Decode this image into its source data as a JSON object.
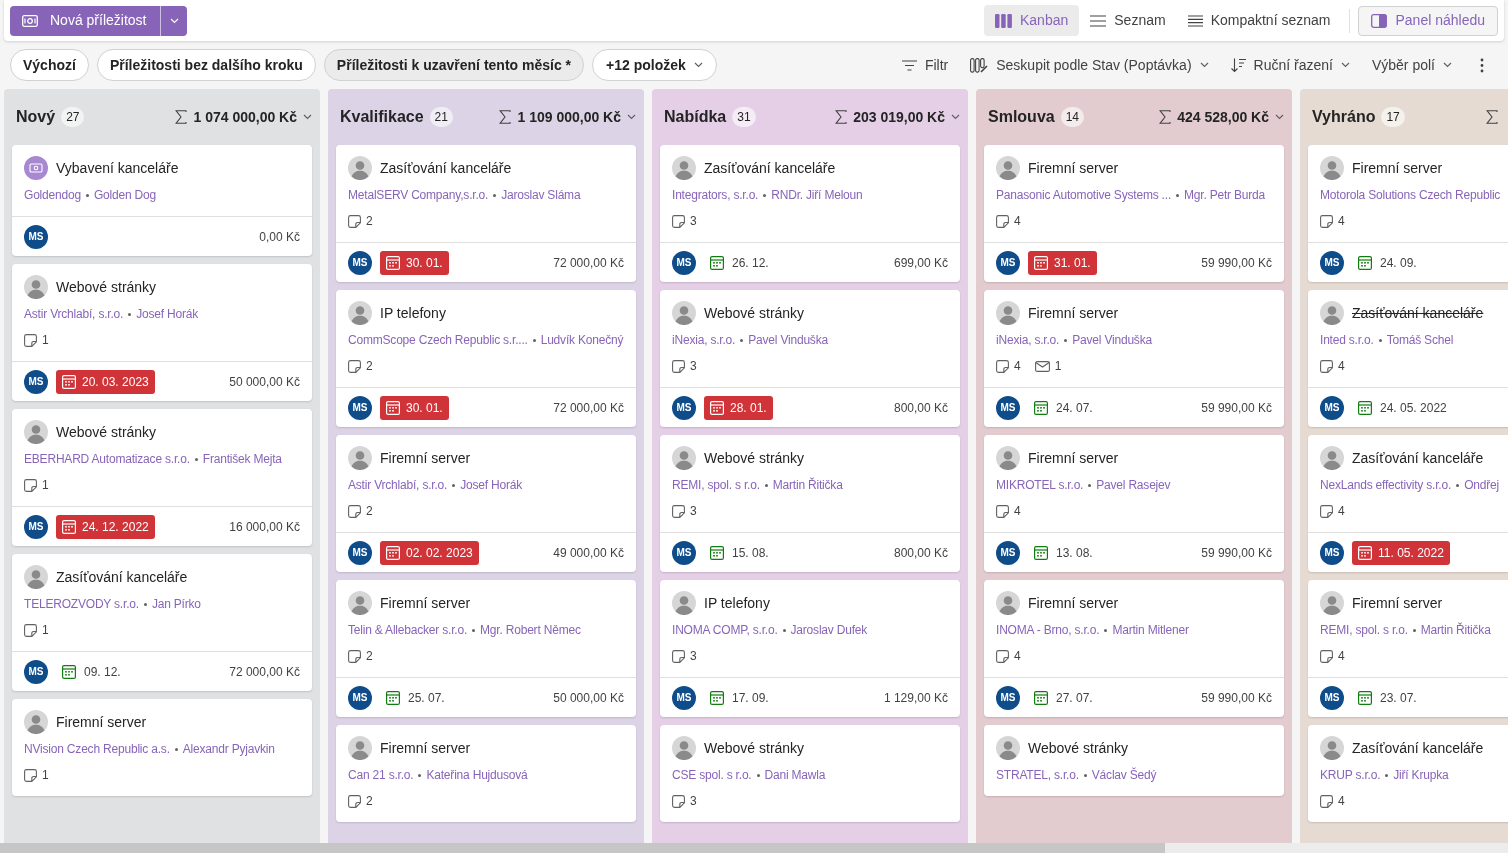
{
  "new_button": {
    "label": "Nová příležitost"
  },
  "views": [
    {
      "label": "Kanban",
      "kind": "kanban",
      "selected": true
    },
    {
      "label": "Seznam",
      "kind": "list",
      "selected": false
    },
    {
      "label": "Kompaktní seznam",
      "kind": "compact",
      "selected": false
    }
  ],
  "preview_button": {
    "label": "Panel náhledu"
  },
  "saved_filters": [
    {
      "label": "Výchozí",
      "selected": false
    },
    {
      "label": "Příležitosti bez dalšího kroku",
      "selected": false
    },
    {
      "label": "Příležitosti k uzavření tento měsíc *",
      "selected": true
    }
  ],
  "more_filters": {
    "label": "+12 položek"
  },
  "commands": [
    {
      "label": "Filtr",
      "kind": "filter",
      "dropdown": false
    },
    {
      "label": "Seskupit podle Stav (Poptávka)",
      "kind": "group",
      "dropdown": true
    },
    {
      "label": "Ruční řazení",
      "kind": "sort",
      "dropdown": true
    },
    {
      "label": "Výběr polí",
      "kind": "fields",
      "dropdown": true
    }
  ],
  "columns": [
    {
      "title": "Nový",
      "count": "27",
      "sum": "1 074 000,00 Kč",
      "color": "#dfe1e2",
      "cards": [
        {
          "kind": "opportunity",
          "title": "Vybavení kanceláře",
          "strikethrough": false,
          "company": "Goldendog",
          "contact": "Golden Dog",
          "footer": {
            "owner": "MS",
            "amount": "0,00 Kč"
          }
        },
        {
          "kind": "person",
          "title": "Webové stránky",
          "strikethrough": false,
          "company": "Astir Vrchlabí, s.r.o.",
          "contact": "Josef Horák",
          "notes": "1",
          "footer": {
            "owner": "MS",
            "date": "20. 03. 2023",
            "overdue": true,
            "amount": "50 000,00 Kč"
          }
        },
        {
          "kind": "person",
          "title": "Webové stránky",
          "strikethrough": false,
          "company": "EBERHARD Automatizace s.r.o.",
          "contact": "František Mejta",
          "notes": "1",
          "footer": {
            "owner": "MS",
            "date": "24. 12. 2022",
            "overdue": true,
            "amount": "16 000,00 Kč"
          }
        },
        {
          "kind": "person",
          "title": "Zasíťování kanceláře",
          "strikethrough": false,
          "company": "TELEROZVODY s.r.o.",
          "contact": "Jan Pírko",
          "notes": "1",
          "footer": {
            "owner": "MS",
            "date": "09. 12.",
            "overdue": false,
            "amount": "72 000,00 Kč"
          }
        },
        {
          "kind": "person",
          "title": "Firemní server",
          "strikethrough": false,
          "company": "NVision Czech Republic a.s.",
          "contact": "Alexandr Pyjavkin",
          "notes": "1"
        }
      ]
    },
    {
      "title": "Kvalifikace",
      "count": "21",
      "sum": "1 109 000,00 Kč",
      "color": "#ddd3e6",
      "cards": [
        {
          "kind": "person",
          "title": "Zasíťování kanceláře",
          "strikethrough": false,
          "company": "MetalSERV Company,s.r.o.",
          "contact": "Jaroslav Sláma",
          "notes": "2",
          "footer": {
            "owner": "MS",
            "date": "30. 01.",
            "overdue": true,
            "amount": "72 000,00 Kč"
          }
        },
        {
          "kind": "person",
          "title": "IP telefony",
          "strikethrough": false,
          "company": "CommScope Czech Republic s.r....",
          "contact": "Ludvík Konečný",
          "notes": "2",
          "footer": {
            "owner": "MS",
            "date": "30. 01.",
            "overdue": true,
            "amount": "72 000,00 Kč"
          }
        },
        {
          "kind": "person",
          "title": "Firemní server",
          "strikethrough": false,
          "company": "Astir Vrchlabí, s.r.o.",
          "contact": "Josef Horák",
          "notes": "2",
          "footer": {
            "owner": "MS",
            "date": "02. 02. 2023",
            "overdue": true,
            "amount": "49 000,00 Kč"
          }
        },
        {
          "kind": "person",
          "title": "Firemní server",
          "strikethrough": false,
          "company": "Telin & Allebacker s.r.o.",
          "contact": "Mgr. Robert Němec",
          "notes": "2",
          "footer": {
            "owner": "MS",
            "date": "25. 07.",
            "overdue": false,
            "amount": "50 000,00 Kč"
          }
        },
        {
          "kind": "person",
          "title": "Firemní server",
          "strikethrough": false,
          "company": "Can 21 s.r.o.",
          "contact": "Kateřina Hujdusová",
          "notes": "2"
        }
      ]
    },
    {
      "title": "Nabídka",
      "count": "31",
      "sum": "203 019,00 Kč",
      "color": "#e5cfe7",
      "cards": [
        {
          "kind": "person",
          "title": "Zasíťování kanceláře",
          "strikethrough": false,
          "company": "Integrators, s.r.o.",
          "contact": "RNDr. Jiří Meloun",
          "notes": "3",
          "footer": {
            "owner": "MS",
            "date": "26. 12.",
            "overdue": false,
            "amount": "699,00 Kč"
          }
        },
        {
          "kind": "person",
          "title": "Webové stránky",
          "strikethrough": false,
          "company": "iNexia, s.r.o.",
          "contact": "Pavel Vinduška",
          "notes": "3",
          "footer": {
            "owner": "MS",
            "date": "28. 01.",
            "overdue": true,
            "amount": "800,00 Kč"
          }
        },
        {
          "kind": "person",
          "title": "Webové stránky",
          "strikethrough": false,
          "company": "REMI, spol. s r.o.",
          "contact": "Martin Řitička",
          "notes": "3",
          "footer": {
            "owner": "MS",
            "date": "15. 08.",
            "overdue": false,
            "amount": "800,00 Kč"
          }
        },
        {
          "kind": "person",
          "title": "IP telefony",
          "strikethrough": false,
          "company": "INOMA COMP, s.r.o.",
          "contact": "Jaroslav Dufek",
          "notes": "3",
          "footer": {
            "owner": "MS",
            "date": "17. 09.",
            "overdue": false,
            "amount": "1 129,00 Kč"
          }
        },
        {
          "kind": "person",
          "title": "Webové stránky",
          "strikethrough": false,
          "company": "CSE spol. s r.o.",
          "contact": "Dani Mawla",
          "notes": "3"
        }
      ]
    },
    {
      "title": "Smlouva",
      "count": "14",
      "sum": "424 528,00 Kč",
      "color": "#e3ccd0",
      "cards": [
        {
          "kind": "person",
          "title": "Firemní server",
          "strikethrough": false,
          "company": "Panasonic Automotive Systems ...",
          "contact": "Mgr. Petr Burda",
          "notes": "4",
          "footer": {
            "owner": "MS",
            "date": "31. 01.",
            "overdue": true,
            "amount": "59 990,00 Kč"
          }
        },
        {
          "kind": "person",
          "title": "Firemní server",
          "strikethrough": false,
          "company": "iNexia, s.r.o.",
          "contact": "Pavel Vinduška",
          "notes": "4",
          "mails": "1",
          "footer": {
            "owner": "MS",
            "date": "24. 07.",
            "overdue": false,
            "amount": "59 990,00 Kč"
          }
        },
        {
          "kind": "person",
          "title": "Firemní server",
          "strikethrough": false,
          "company": "MIKROTEL s.r.o.",
          "contact": "Pavel Rasejev",
          "notes": "4",
          "footer": {
            "owner": "MS",
            "date": "13. 08.",
            "overdue": false,
            "amount": "59 990,00 Kč"
          }
        },
        {
          "kind": "person",
          "title": "Firemní server",
          "strikethrough": false,
          "company": "INOMA - Brno, s.r.o.",
          "contact": "Martin Mitlener",
          "notes": "4",
          "footer": {
            "owner": "MS",
            "date": "27. 07.",
            "overdue": false,
            "amount": "59 990,00 Kč"
          }
        },
        {
          "kind": "person",
          "title": "Webové stránky",
          "strikethrough": false,
          "company": "STRATEL, s.r.o.",
          "contact": "Václav Šedý"
        }
      ]
    },
    {
      "title": "Vyhráno",
      "count": "17",
      "color": "#e6dbd2",
      "cards": [
        {
          "kind": "person",
          "title": "Firemní server",
          "strikethrough": false,
          "company": "Motorola Solutions Czech Republic",
          "notes": "4",
          "footer": {
            "owner": "MS",
            "date": "24. 09.",
            "overdue": false
          }
        },
        {
          "kind": "person",
          "title": "Zasíťování kanceláře",
          "strikethrough": true,
          "company": "Inted s.r.o.",
          "contact": "Tomáš Schel",
          "notes": "4",
          "footer": {
            "owner": "MS",
            "date": "24. 05. 2022",
            "overdue": false
          }
        },
        {
          "kind": "person",
          "title": "Zasíťování kanceláře",
          "strikethrough": false,
          "company": "NexLands effectivity s.r.o.",
          "contact": "Ondřej",
          "notes": "4",
          "footer": {
            "owner": "MS",
            "date": "11. 05. 2022",
            "overdue": true
          }
        },
        {
          "kind": "person",
          "title": "Firemní server",
          "strikethrough": false,
          "company": "REMI, spol. s r.o.",
          "contact": "Martin Řitička",
          "notes": "4",
          "footer": {
            "owner": "MS",
            "date": "23. 07.",
            "overdue": false
          }
        },
        {
          "kind": "person",
          "title": "Zasíťování kanceláře",
          "strikethrough": false,
          "company": "KRUP s.r.o.",
          "contact": "Jiří Krupka",
          "notes": "4"
        }
      ]
    }
  ]
}
